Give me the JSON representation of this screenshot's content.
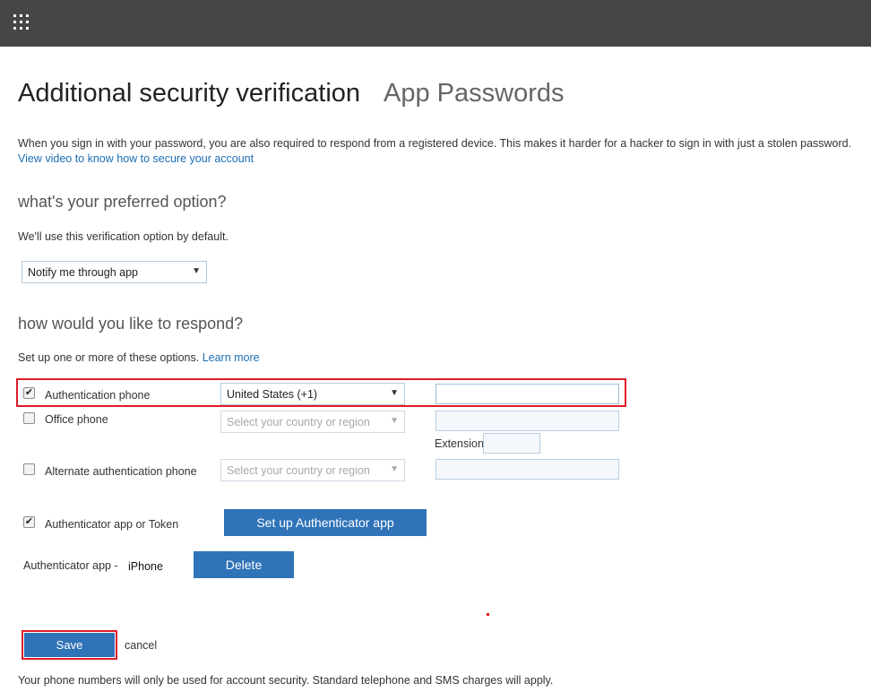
{
  "header": {
    "waffle_icon": "app-launcher-icon"
  },
  "page": {
    "title": "Additional security verification",
    "tab_app_passwords": "App Passwords",
    "intro_text": "When you sign in with your password, you are also required to respond from a registered device. This makes it harder for a hacker to sign in with just a stolen password.",
    "intro_link": "View video to know how to secure your account"
  },
  "preferred": {
    "heading": "what's your preferred option?",
    "description": "We'll use this verification option by default.",
    "selected": "Notify me through app"
  },
  "respond": {
    "heading": "how would you like to respond?",
    "description": "Set up one or more of these options.",
    "learn_more": "Learn more",
    "auth_phone": {
      "label": "Authentication phone",
      "checked": true,
      "country": "United States (+1)",
      "number": ""
    },
    "office_phone": {
      "label": "Office phone",
      "checked": false,
      "country_placeholder": "Select your country or region",
      "extension_label": "Extension"
    },
    "alt_phone": {
      "label": "Alternate authentication phone",
      "checked": false,
      "country_placeholder": "Select your country or region"
    },
    "authenticator": {
      "label": "Authenticator app or Token",
      "checked": true,
      "setup_button": "Set up Authenticator app"
    },
    "device": {
      "label": "Authenticator app -",
      "device_name": "iPhone",
      "delete_button": "Delete"
    }
  },
  "footer": {
    "save": "Save",
    "cancel": "cancel",
    "note": "Your phone numbers will only be used for account security. Standard telephone and SMS charges will apply."
  },
  "colors": {
    "topbar": "#474646",
    "accent": "#2f73b8",
    "link": "#1a6eb5",
    "highlight": "#e01b2a"
  }
}
